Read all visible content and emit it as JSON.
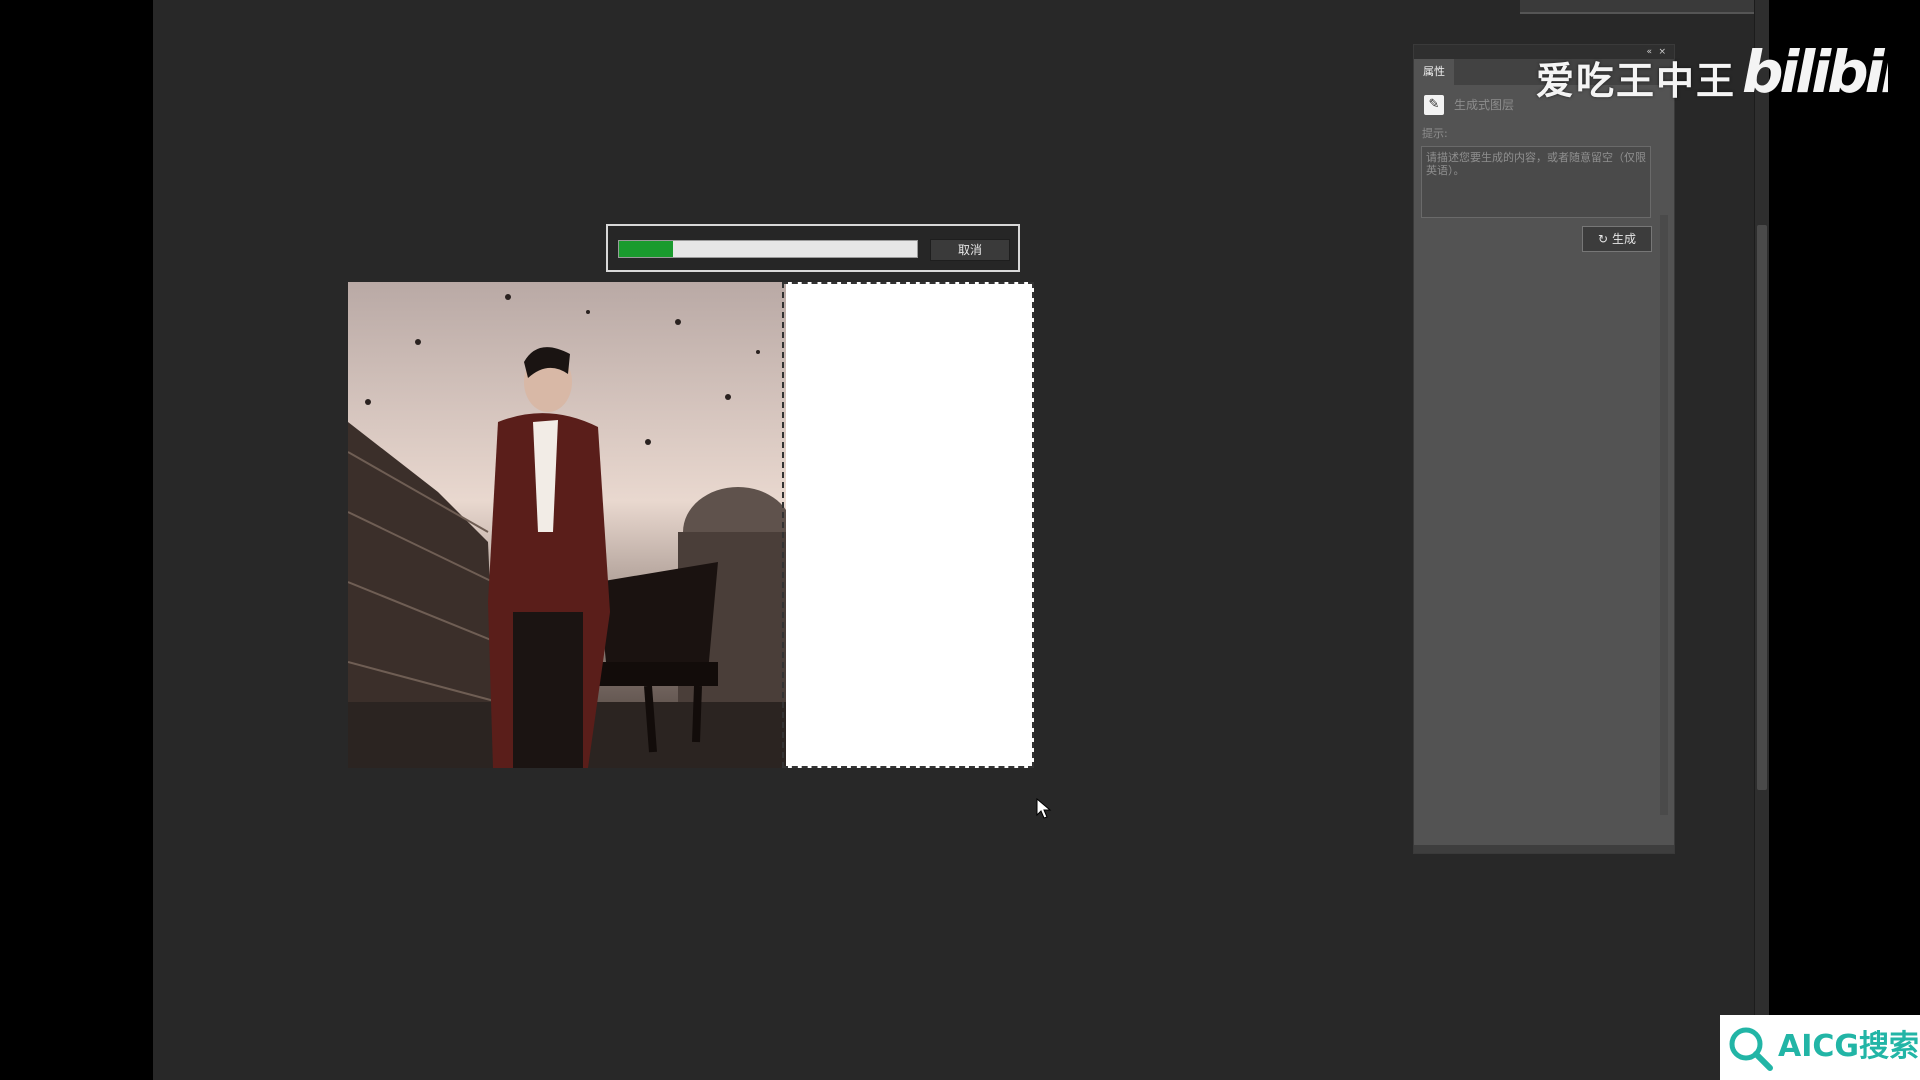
{
  "progress": {
    "percent": 18,
    "cancel_label": "取消"
  },
  "properties_panel": {
    "tab_label": "属性",
    "collapse_glyph": "«",
    "close_glyph": "×",
    "layer_type_label": "生成式图层",
    "prompt_label": "提示:",
    "prompt_placeholder": "请描述您要生成的内容，或者随意留空（仅限英语）。",
    "generate_label": "生成"
  },
  "watermarks": {
    "channel_name": "爱吃王中王",
    "bilibili_logo": "bilibili",
    "aicg_text": "AICG搜索"
  },
  "colors": {
    "progress_fill": "#1a9b2e",
    "aicg_brand": "#22b5a6"
  },
  "icons": {
    "layer_type": "generative-layer-icon",
    "generate": "refresh-icon",
    "cursor": "mouse-pointer-icon"
  }
}
